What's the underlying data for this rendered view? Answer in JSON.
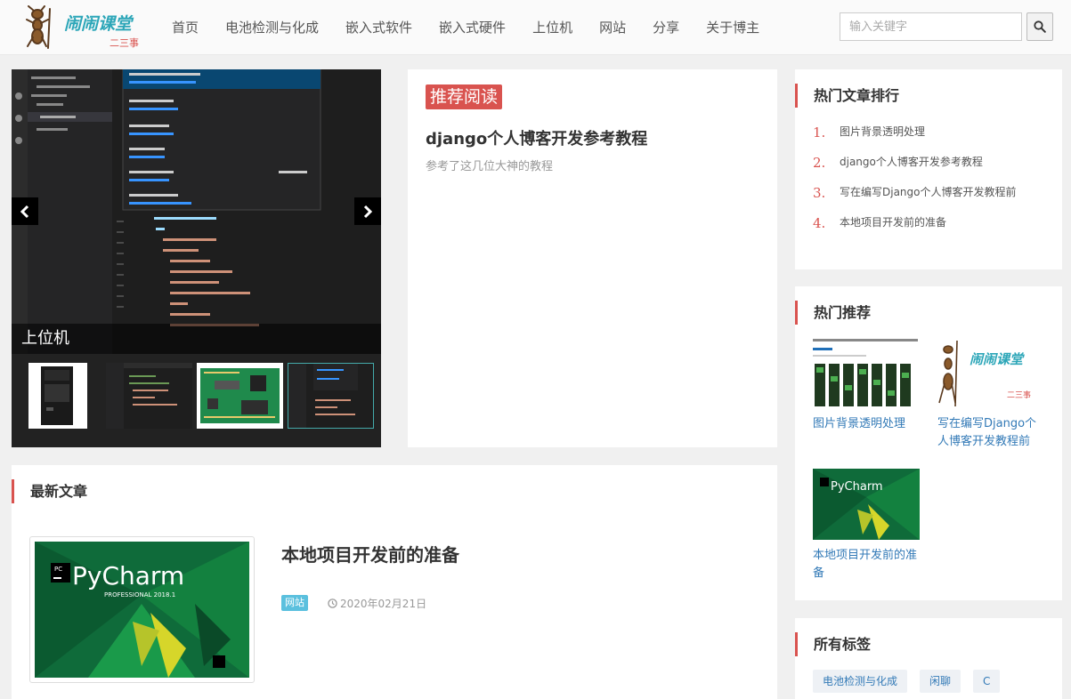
{
  "header": {
    "logo_text": "闹闹课堂",
    "logo_sub": "二三事",
    "nav": [
      "首页",
      "电池检测与化成",
      "嵌入式软件",
      "嵌入式硬件",
      "上位机",
      "网站",
      "分享",
      "关于博主"
    ],
    "search_placeholder": "输入关键字"
  },
  "carousel": {
    "caption": "上位机",
    "thumbnails": [
      "pc-case",
      "code-editor",
      "circuit-board",
      "code-editor"
    ]
  },
  "recommend": {
    "badge": "推荐阅读",
    "title": "django个人博客开发参考教程",
    "desc": "参考了这几位大神的教程"
  },
  "latest": {
    "heading": "最新文章",
    "article": {
      "title": "本地项目开发前的准备",
      "tag": "网站",
      "date": "2020年02月21日",
      "image_label": "PyCharm",
      "image_sub": "PROFESSIONAL 2018.1"
    }
  },
  "sidebar": {
    "hot": {
      "heading": "热门文章排行",
      "items": [
        {
          "num": "1.",
          "text": "图片背景透明处理"
        },
        {
          "num": "2.",
          "text": "django个人博客开发参考教程"
        },
        {
          "num": "3.",
          "text": "写在编写Django个人博客开发教程前"
        },
        {
          "num": "4.",
          "text": "本地项目开发前的准备"
        }
      ]
    },
    "recommend": {
      "heading": "热门推荐",
      "cards": [
        {
          "title": "图片背景透明处理"
        },
        {
          "title": "写在编写Django个人博客开发教程前"
        },
        {
          "title": "本地项目开发前的准备"
        }
      ]
    },
    "tags": {
      "heading": "所有标签",
      "items": [
        "电池检测与化成",
        "闲聊",
        "C"
      ]
    }
  },
  "colors": {
    "accent": "#d9534f",
    "link": "#337ab7",
    "tag_blue": "#5bc0de"
  }
}
